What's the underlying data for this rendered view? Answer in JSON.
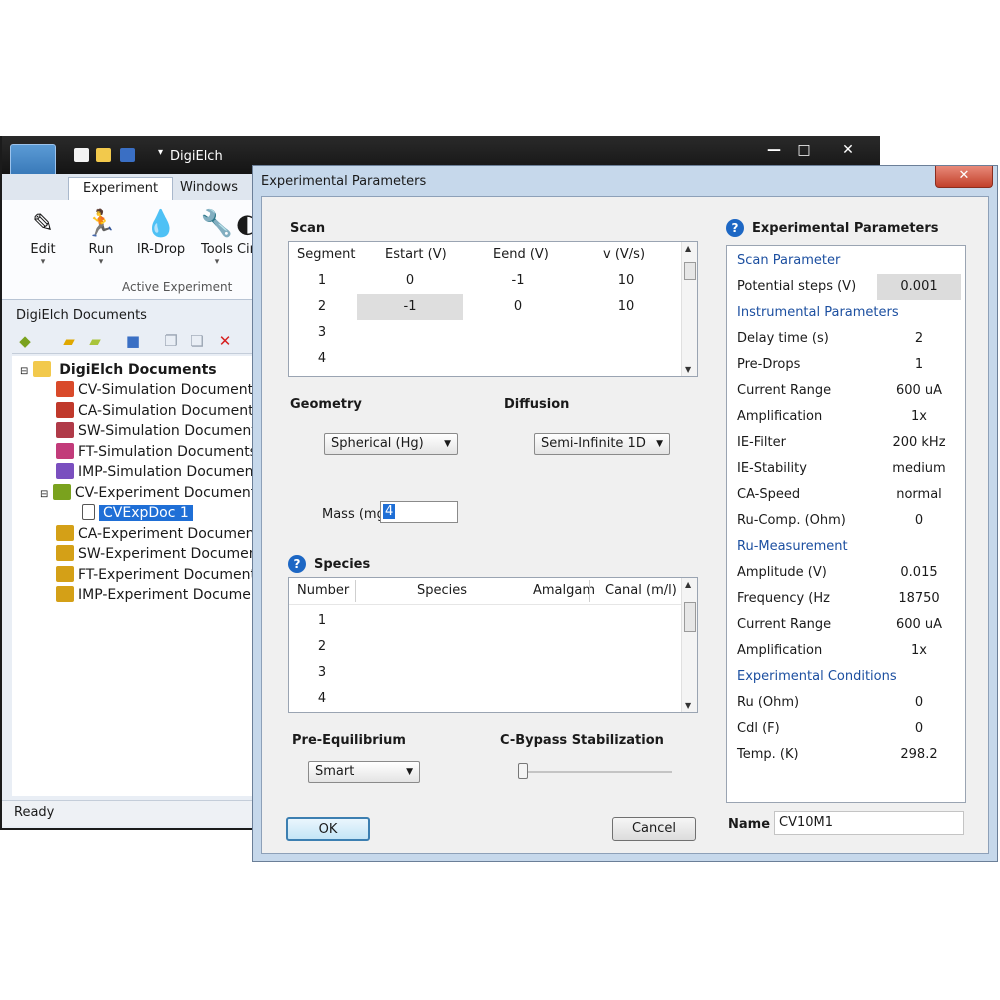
{
  "main_window": {
    "title": "DigiElch",
    "window_controls": {
      "minimize": "—",
      "maximize": "□",
      "close": "✕"
    },
    "ribbon_tabs": [
      "Experiment",
      "Windows"
    ],
    "ribbon_buttons": [
      {
        "label": "Edit",
        "glyph": "✎"
      },
      {
        "label": "Run",
        "glyph": "🏃"
      },
      {
        "label": "IR-Drop",
        "glyph": "💧"
      },
      {
        "label": "Tools",
        "glyph": "🔧"
      },
      {
        "label": "Cir",
        "glyph": "◐"
      }
    ],
    "ribbon_group_label": "Active Experiment",
    "docs_pane_title": "DigiElch Documents",
    "tree": {
      "root": "DigiElch Documents",
      "items": [
        {
          "label": "CV-Simulation Documents",
          "color": "#d94a2a"
        },
        {
          "label": "CA-Simulation Documents",
          "color": "#c0392b"
        },
        {
          "label": "SW-Simulation Documents",
          "color": "#b03a48"
        },
        {
          "label": "FT-Simulation Documents",
          "color": "#c23b7a"
        },
        {
          "label": "IMP-Simulation Documents",
          "color": "#7a4fbf"
        },
        {
          "label": "CV-Experiment Documents",
          "color": "#7aa21e"
        },
        {
          "label": "CVExpDoc 1",
          "color": "#ffffff"
        },
        {
          "label": "CA-Experiment Documents",
          "color": "#d4a017"
        },
        {
          "label": "SW-Experiment Documents",
          "color": "#d4a017"
        },
        {
          "label": "FT-Experiment Documents",
          "color": "#d4a017"
        },
        {
          "label": "IMP-Experiment Documents",
          "color": "#d4a017"
        }
      ]
    },
    "status": "Ready"
  },
  "dialog": {
    "title": "Experimental Parameters",
    "close_glyph": "✕",
    "scan": {
      "title": "Scan",
      "columns": [
        "Segment",
        "Estart (V)",
        "Eend (V)",
        "v (V/s)"
      ],
      "rows": [
        [
          "1",
          "0",
          "-1",
          "10"
        ],
        [
          "2",
          "-1",
          "0",
          "10"
        ],
        [
          "3",
          "",
          "",
          ""
        ],
        [
          "4",
          "",
          "",
          ""
        ]
      ]
    },
    "geometry": {
      "title": "Geometry",
      "value": "Spherical (Hg)",
      "mass_label": "Mass (mg)",
      "mass_value": "4"
    },
    "diffusion": {
      "title": "Diffusion",
      "value": "Semi-Infinite 1D"
    },
    "species": {
      "title": "Species",
      "columns": [
        "Number",
        "Species",
        "Amalgam",
        "Canal (m/l)"
      ],
      "rows": [
        "1",
        "2",
        "3",
        "4"
      ]
    },
    "pre_equilibrium": {
      "title": "Pre-Equilibrium",
      "value": "Smart"
    },
    "cbypass": {
      "title": "C-Bypass Stabilization",
      "level": 0
    },
    "ok_label": "OK",
    "cancel_label": "Cancel",
    "exp_params": {
      "title": "Experimental Parameters",
      "sections": [
        {
          "header": "Scan Parameter",
          "rows": [
            {
              "label": "Potential steps (V)",
              "value": "0.001"
            }
          ]
        },
        {
          "header": "Instrumental Parameters",
          "rows": [
            {
              "label": "Delay time (s)",
              "value": "2"
            },
            {
              "label": "Pre-Drops",
              "value": "1"
            },
            {
              "label": "Current Range",
              "value": "600 uA"
            },
            {
              "label": "Amplification",
              "value": "1x"
            },
            {
              "label": "IE-Filter",
              "value": "200 kHz"
            },
            {
              "label": "IE-Stability",
              "value": "medium"
            },
            {
              "label": "CA-Speed",
              "value": "normal"
            },
            {
              "label": "Ru-Comp. (Ohm)",
              "value": "0"
            }
          ]
        },
        {
          "header": "Ru-Measurement",
          "rows": [
            {
              "label": "Amplitude (V)",
              "value": "0.015"
            },
            {
              "label": "Frequency (Hz",
              "value": "18750"
            },
            {
              "label": "Current Range",
              "value": "600 uA"
            },
            {
              "label": "Amplification",
              "value": "1x"
            }
          ]
        },
        {
          "header": "Experimental Conditions",
          "rows": [
            {
              "label": "Ru (Ohm)",
              "value": "0"
            },
            {
              "label": "Cdl (F)",
              "value": "0"
            },
            {
              "label": "Temp. (K)",
              "value": "298.2"
            }
          ]
        }
      ]
    },
    "name_label": "Name",
    "name_value": "CV10M1"
  }
}
